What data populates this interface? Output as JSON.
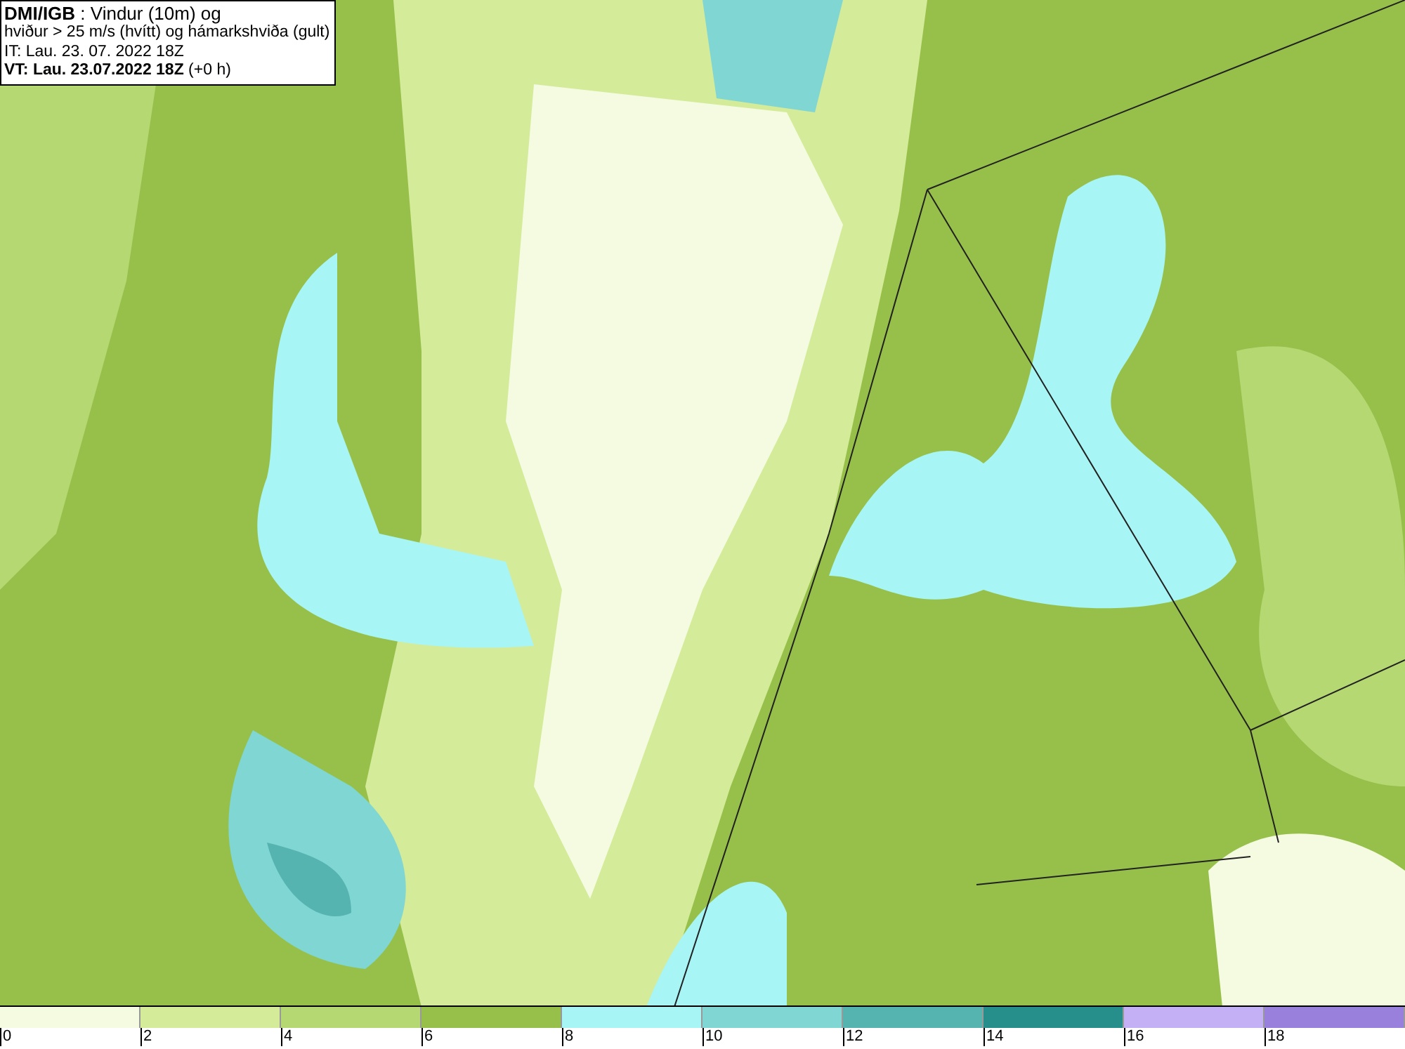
{
  "legend": {
    "lines": [
      "**DMI/IGB** : Vindur (10m) og",
      "hviður > 25 m/s (hvítt) og hámarkshviða (gult)",
      "IT: Lau. 23. 07. 2022 18Z",
      "**VT: Lau. 23.07.2022 18Z** (+0 h)"
    ]
  },
  "colorbar": {
    "bins": [
      {
        "color": "#f4fbe0",
        "label": "0"
      },
      {
        "color": "#d4eb9a",
        "label": "2"
      },
      {
        "color": "#b5d873",
        "label": "4"
      },
      {
        "color": "#96c04a",
        "label": "6"
      },
      {
        "color": "#a8f5f5",
        "label": "8"
      },
      {
        "color": "#7fd6d3",
        "label": "10"
      },
      {
        "color": "#55b3b0",
        "label": "12"
      },
      {
        "color": "#268f8b",
        "label": "14"
      },
      {
        "color": "#c3b0f5",
        "label": "16"
      },
      {
        "color": "#9a80dd",
        "label": "18"
      }
    ]
  }
}
